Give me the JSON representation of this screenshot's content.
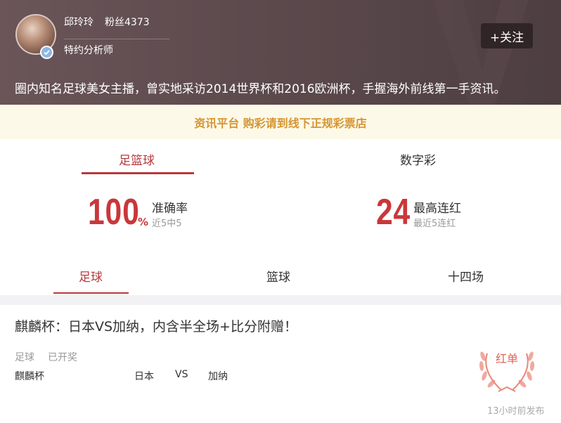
{
  "header": {
    "name": "邱玲玲",
    "fans": "粉丝4373",
    "role": "特约分析师",
    "follow_label": "+关注",
    "bio": "圈内知名足球美女主播，曾实地采访2014世界杯和2016欧洲杯，手握海外前线第一手资讯。"
  },
  "notice": "资讯平台 购彩请到线下正规彩票店",
  "main_tabs": [
    {
      "label": "足篮球",
      "active": true
    },
    {
      "label": "数字彩",
      "active": false
    }
  ],
  "stats": {
    "accuracy_value": "100",
    "accuracy_unit": "%",
    "accuracy_label": "准确率",
    "accuracy_sub": "近5中5",
    "streak_value": "24",
    "streak_label": "最高连红",
    "streak_sub": "最近5连红"
  },
  "sub_tabs": [
    {
      "label": "足球",
      "active": true
    },
    {
      "label": "篮球",
      "active": false
    },
    {
      "label": "十四场",
      "active": false
    }
  ],
  "card": {
    "title": "麒麟杯：日本VS加纳，内含半全场+比分附赠！",
    "category": "足球",
    "status": "已开奖",
    "league": "麒麟杯",
    "home": "日本",
    "vs": "VS",
    "away": "加纳",
    "badge": "红单",
    "time": "13小时前发布"
  },
  "colors": {
    "accent": "#b73a3d",
    "notice_text": "#d59532",
    "badge": "#e26458"
  }
}
